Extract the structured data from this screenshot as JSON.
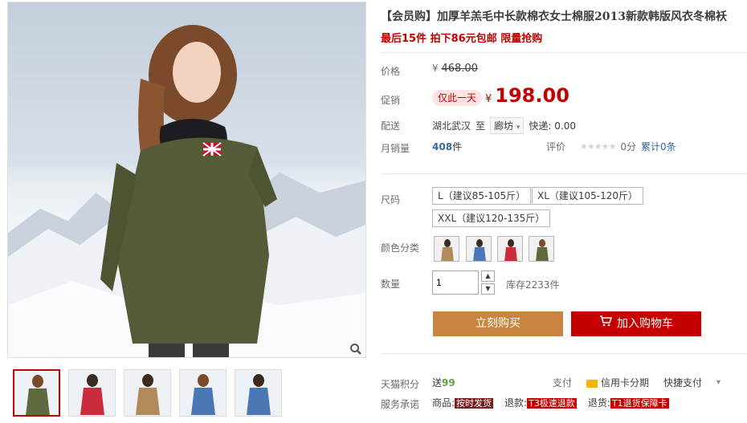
{
  "product": {
    "title": "【会员购】加厚羊羔毛中长款棉衣女士棉服2013新款韩版风衣冬棉袄",
    "subtitle": "最后15件 拍下86元包邮 限量抢购"
  },
  "price": {
    "label": "价格",
    "currency": "¥",
    "original": "468.00"
  },
  "promo": {
    "label": "促销",
    "tag": "仅此一天",
    "currency": "¥",
    "value": "198.00"
  },
  "shipping": {
    "label": "配送",
    "from": "湖北武汉",
    "to_word": "至",
    "to_city": "廊坊",
    "express": "快递: 0.00"
  },
  "sales": {
    "label": "月销量",
    "count": "408",
    "unit": "件"
  },
  "rating": {
    "label": "评价",
    "stars": "★★★★★",
    "score": "0分",
    "total": "累计0条"
  },
  "size": {
    "label": "尺码",
    "options": [
      "L（建议85-105斤）",
      "XL（建议105-120斤）",
      "XXL（建议120-135斤）"
    ]
  },
  "color": {
    "label": "颜色分类",
    "options": [
      {
        "name": "beige",
        "color": "#b38a5c"
      },
      {
        "name": "blue",
        "color": "#4b78b5"
      },
      {
        "name": "red",
        "color": "#cc2a3d"
      },
      {
        "name": "army-green",
        "color": "#5d6a3e"
      }
    ]
  },
  "quantity": {
    "label": "数量",
    "value": "1",
    "stock": "库存2233件"
  },
  "buttons": {
    "buy_now": "立刻购买",
    "add_cart": "加入购物车"
  },
  "points": {
    "label": "天猫积分",
    "prefix": "送",
    "value": "99"
  },
  "payment": {
    "label": "支付",
    "credit": "信用卡分期",
    "fast": "快捷支付"
  },
  "service": {
    "label": "服务承诺",
    "goods_label": "商品:",
    "goods_tag": "按时发货",
    "refund_label": "退款:",
    "refund_tag": "T3极速退款",
    "return_label": "退货:",
    "return_tag": "T1退货保障卡"
  },
  "thumbnails": [
    {
      "name": "green-coat",
      "color": "#5d6a3e"
    },
    {
      "name": "red-coat",
      "color": "#cc2a3d"
    },
    {
      "name": "beige-coat",
      "color": "#b38a5c"
    },
    {
      "name": "blue-coat",
      "color": "#4b78b5"
    },
    {
      "name": "blue-back",
      "color": "#4b78b5"
    }
  ],
  "icons": {
    "zoom": "magnifier-icon",
    "cart": "shopping-cart-icon",
    "dropdown": "chevron-down-icon",
    "card": "credit-card-icon"
  }
}
